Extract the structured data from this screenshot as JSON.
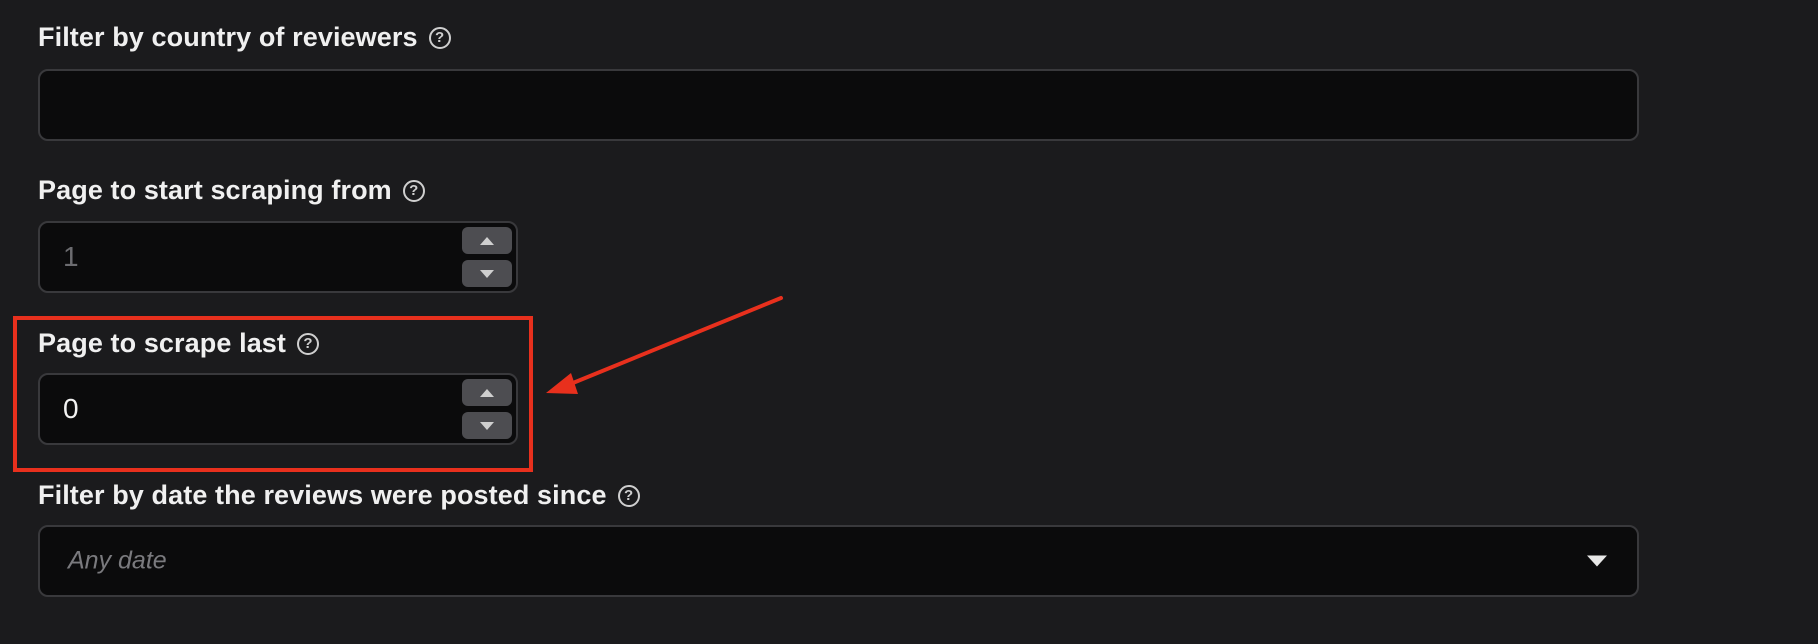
{
  "form": {
    "country_filter": {
      "label": "Filter by country of reviewers",
      "value": ""
    },
    "start_page": {
      "label": "Page to start scraping from",
      "placeholder": "1"
    },
    "last_page": {
      "label": "Page to scrape last",
      "value": "0"
    },
    "date_filter": {
      "label": "Filter by date the reviews were posted since",
      "placeholder": "Any date"
    },
    "help_symbol": "?"
  },
  "annotation": {
    "highlight_color": "#e8301d",
    "arrow_color": "#e8301d",
    "target": "Page to scrape last"
  },
  "icons": [
    "help-icon",
    "chevron-up-icon",
    "chevron-down-icon",
    "dropdown-caret-icon",
    "annotation-arrow-icon"
  ]
}
